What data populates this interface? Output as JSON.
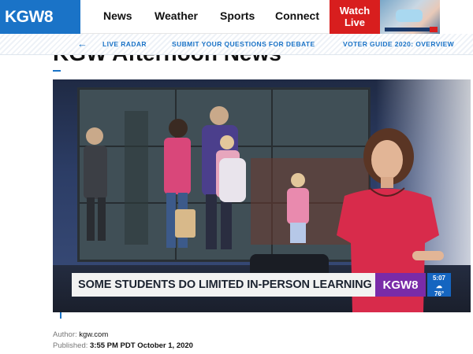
{
  "header": {
    "logo_text": "KGW8",
    "nav": [
      {
        "label": "News"
      },
      {
        "label": "Weather"
      },
      {
        "label": "Sports"
      },
      {
        "label": "Connect"
      }
    ],
    "watch_live_line1": "Watch",
    "watch_live_line2": "Live"
  },
  "subnav": {
    "items": [
      {
        "label": "LIVE RADAR"
      },
      {
        "label": "SUBMIT YOUR QUESTIONS FOR DEBATE"
      },
      {
        "label": "VOTER GUIDE 2020: OVERVIEW"
      }
    ]
  },
  "article": {
    "headline": "KGW Afternoon News"
  },
  "video": {
    "lower_third": "SOME STUDENTS DO LIMITED IN-PERSON LEARNING",
    "bug_logo": "KGW8",
    "bug_time": "5:07",
    "bug_temp": "76°"
  },
  "meta": {
    "author_label": "Author:",
    "author": "kgw.com",
    "published_label": "Published:",
    "published": "3:55 PM PDT October 1, 2020"
  },
  "colors": {
    "brand_blue": "#1a73c7",
    "live_red": "#d81e1e",
    "bug_purple": "#7a2ba8"
  }
}
